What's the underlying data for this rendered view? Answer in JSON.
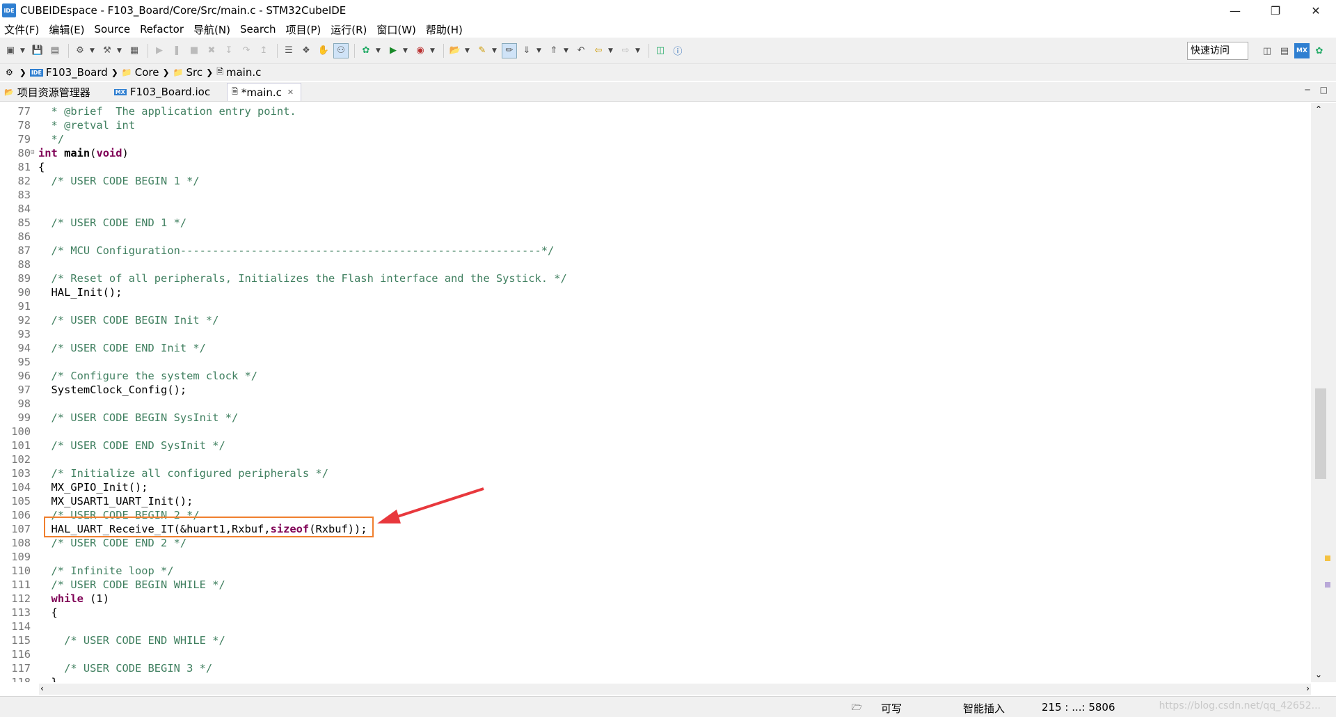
{
  "window": {
    "app_icon": "IDE",
    "title": "CUBEIDEspace - F103_Board/Core/Src/main.c - STM32CubeIDE",
    "controls": [
      "minimize",
      "restore",
      "close"
    ]
  },
  "menu": [
    "文件(F)",
    "编辑(E)",
    "Source",
    "Refactor",
    "导航(N)",
    "Search",
    "项目(P)",
    "运行(R)",
    "窗口(W)",
    "帮助(H)"
  ],
  "toolbar": {
    "quick_access": "快速访问",
    "icons": [
      "new-icon",
      "save-icon",
      "save-all-icon",
      "build-icon",
      "hammer-icon",
      "run-icon",
      "debug-icon",
      "info-icon"
    ]
  },
  "breadcrumb": [
    "F103_Board",
    "Core",
    "Src",
    "main.c"
  ],
  "tabs": [
    {
      "label": "项目资源管理器",
      "icon": "project-explorer-icon"
    },
    {
      "label": "F103_Board.ioc",
      "icon": "mx-icon"
    },
    {
      "label": "*main.c",
      "icon": "c-file-icon",
      "active": true
    }
  ],
  "editor": {
    "lines": [
      {
        "n": "77",
        "text": "  * @brief  The application entry point."
      },
      {
        "n": "78",
        "text": "  * @retval int"
      },
      {
        "n": "79",
        "text": "  */"
      },
      {
        "n": "80",
        "text": "int main(void)"
      },
      {
        "n": "81",
        "text": "{"
      },
      {
        "n": "82",
        "text": "  /* USER CODE BEGIN 1 */"
      },
      {
        "n": "83",
        "text": ""
      },
      {
        "n": "84",
        "text": ""
      },
      {
        "n": "85",
        "text": "  /* USER CODE END 1 */"
      },
      {
        "n": "86",
        "text": ""
      },
      {
        "n": "87",
        "text": "  /* MCU Configuration--------------------------------------------------------*/"
      },
      {
        "n": "88",
        "text": ""
      },
      {
        "n": "89",
        "text": "  /* Reset of all peripherals, Initializes the Flash interface and the Systick. */"
      },
      {
        "n": "90",
        "text": "  HAL_Init();"
      },
      {
        "n": "91",
        "text": ""
      },
      {
        "n": "92",
        "text": "  /* USER CODE BEGIN Init */"
      },
      {
        "n": "93",
        "text": ""
      },
      {
        "n": "94",
        "text": "  /* USER CODE END Init */"
      },
      {
        "n": "95",
        "text": ""
      },
      {
        "n": "96",
        "text": "  /* Configure the system clock */"
      },
      {
        "n": "97",
        "text": "  SystemClock_Config();"
      },
      {
        "n": "98",
        "text": ""
      },
      {
        "n": "99",
        "text": "  /* USER CODE BEGIN SysInit */"
      },
      {
        "n": "100",
        "text": ""
      },
      {
        "n": "101",
        "text": "  /* USER CODE END SysInit */"
      },
      {
        "n": "102",
        "text": ""
      },
      {
        "n": "103",
        "text": "  /* Initialize all configured peripherals */"
      },
      {
        "n": "104",
        "text": "  MX_GPIO_Init();"
      },
      {
        "n": "105",
        "text": "  MX_USART1_UART_Init();"
      },
      {
        "n": "106",
        "text": "  /* USER CODE BEGIN 2 */"
      },
      {
        "n": "107",
        "text": "  HAL_UART_Receive_IT(&huart1,Rxbuf,sizeof(Rxbuf));"
      },
      {
        "n": "108",
        "text": "  /* USER CODE END 2 */"
      },
      {
        "n": "109",
        "text": ""
      },
      {
        "n": "110",
        "text": "  /* Infinite loop */"
      },
      {
        "n": "111",
        "text": "  /* USER CODE BEGIN WHILE */"
      },
      {
        "n": "112",
        "text": "  while (1)"
      },
      {
        "n": "113",
        "text": "  {"
      },
      {
        "n": "114",
        "text": ""
      },
      {
        "n": "115",
        "text": "    /* USER CODE END WHILE */"
      },
      {
        "n": "116",
        "text": ""
      },
      {
        "n": "117",
        "text": "    /* USER CODE BEGIN 3 */"
      },
      {
        "n": "118",
        "text": "  }"
      }
    ]
  },
  "status": {
    "writable": "可写",
    "insert_mode": "智能插入",
    "position": "215 : ...: 5806",
    "watermark": "https://blog.csdn.net/qq_42652..."
  },
  "colors": {
    "comment": "#3f7f5f",
    "keyword": "#7f0055",
    "highlight_box": "#f07f2e",
    "arrow": "#e8383d"
  }
}
